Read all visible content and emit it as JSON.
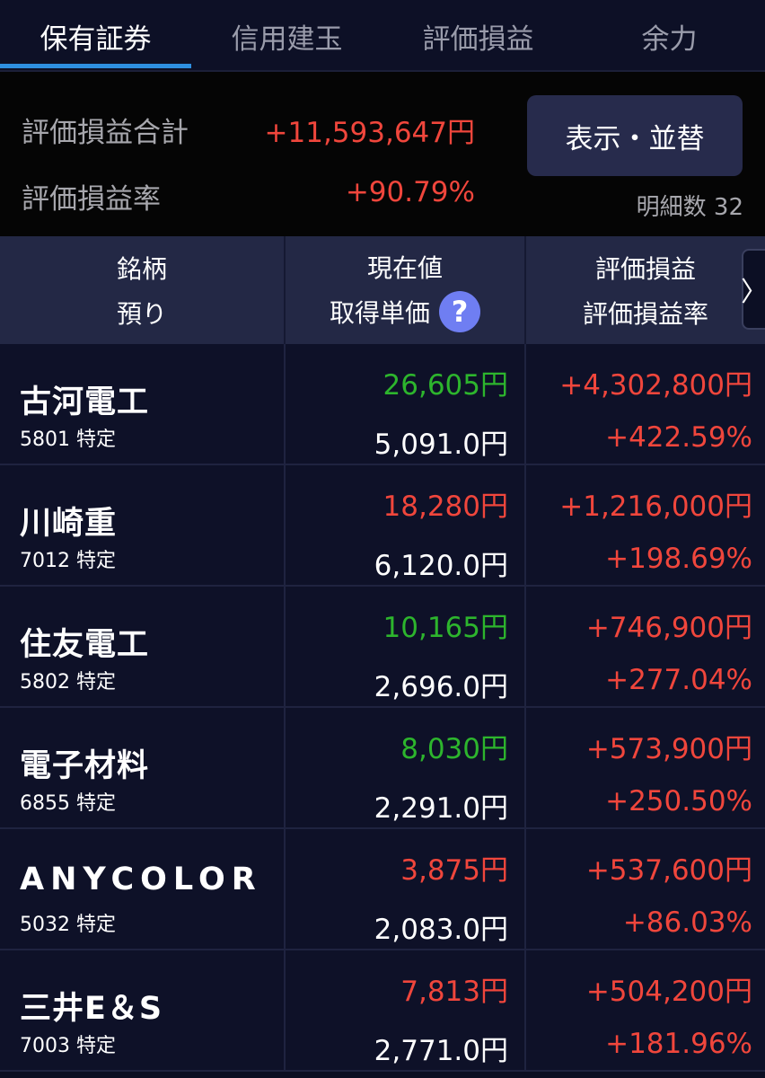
{
  "tabs": [
    {
      "label": "保有証券",
      "active": true
    },
    {
      "label": "信用建玉",
      "active": false
    },
    {
      "label": "評価損益",
      "active": false
    },
    {
      "label": "余力",
      "active": false
    }
  ],
  "summary": {
    "pl_total_label": "評価損益合計",
    "pl_total_value": "+11,593,647円",
    "pl_rate_label": "評価損益率",
    "pl_rate_value": "+90.79%",
    "display_sort_button": "表示・並替",
    "detail_count": "明細数 32"
  },
  "header": {
    "col1_top": "銘柄",
    "col1_bottom": "預り",
    "col2_top": "現在値",
    "col2_bottom": "取得単価",
    "col3_top": "評価損益",
    "col3_bottom": "評価損益率",
    "help_icon": "?",
    "next_arrow": "〉"
  },
  "colors": {
    "up_green": "#2db52d",
    "down_red": "#f0463c",
    "tab_indicator": "#2e8fe0",
    "help_icon_bg": "#6f7ef2"
  },
  "holdings": [
    {
      "name": "古河電工",
      "code": "5801 特定",
      "price": "26,605円",
      "price_color": "#2db52d",
      "cost": "5,091.0円",
      "pl": "+4,302,800円",
      "pl_rate": "+422.59%"
    },
    {
      "name": "川崎重",
      "code": "7012 特定",
      "price": "18,280円",
      "price_color": "#f0463c",
      "cost": "6,120.0円",
      "pl": "+1,216,000円",
      "pl_rate": "+198.69%"
    },
    {
      "name": "住友電工",
      "code": "5802 特定",
      "price": "10,165円",
      "price_color": "#2db52d",
      "cost": "2,696.0円",
      "pl": "+746,900円",
      "pl_rate": "+277.04%"
    },
    {
      "name": "電子材料",
      "code": "6855 特定",
      "price": "8,030円",
      "price_color": "#2db52d",
      "cost": "2,291.0円",
      "pl": "+573,900円",
      "pl_rate": "+250.50%"
    },
    {
      "name": "ANYCOLOR",
      "code": "5032 特定",
      "price": "3,875円",
      "price_color": "#f0463c",
      "cost": "2,083.0円",
      "pl": "+537,600円",
      "pl_rate": "+86.03%"
    },
    {
      "name": "三井E＆S",
      "code": "7003 特定",
      "price": "7,813円",
      "price_color": "#f0463c",
      "cost": "2,771.0円",
      "pl": "+504,200円",
      "pl_rate": "+181.96%"
    }
  ]
}
